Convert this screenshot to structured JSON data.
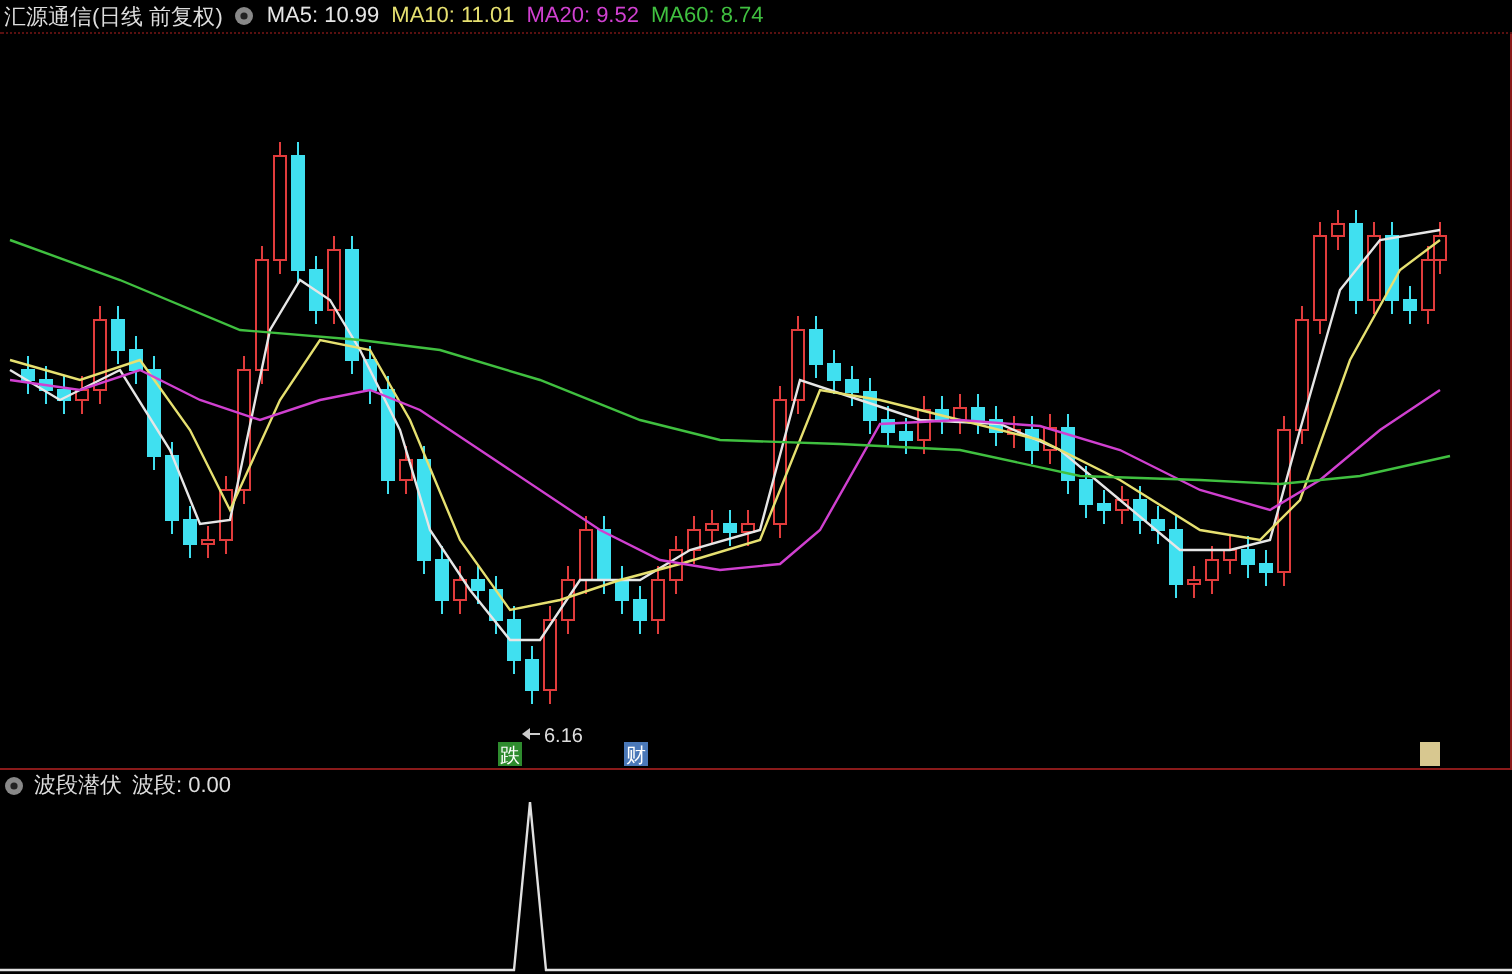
{
  "header": {
    "title": "汇源通信(日线 前复权)",
    "indicators": [
      {
        "label": "MA5: 10.99",
        "color": "#e6e6e6"
      },
      {
        "label": "MA10: 11.01",
        "color": "#e6e070"
      },
      {
        "label": "MA20: 9.52",
        "color": "#d040d0"
      },
      {
        "label": "MA60: 8.74",
        "color": "#40c040"
      }
    ]
  },
  "chart": {
    "low_label": "6.16",
    "markers": [
      {
        "text": "跌",
        "color": "#2e8b2e"
      },
      {
        "text": "财",
        "color": "#4a78b8"
      }
    ]
  },
  "lower_panel": {
    "title": "波段潜伏",
    "reading": "波段: 0.00"
  }
}
